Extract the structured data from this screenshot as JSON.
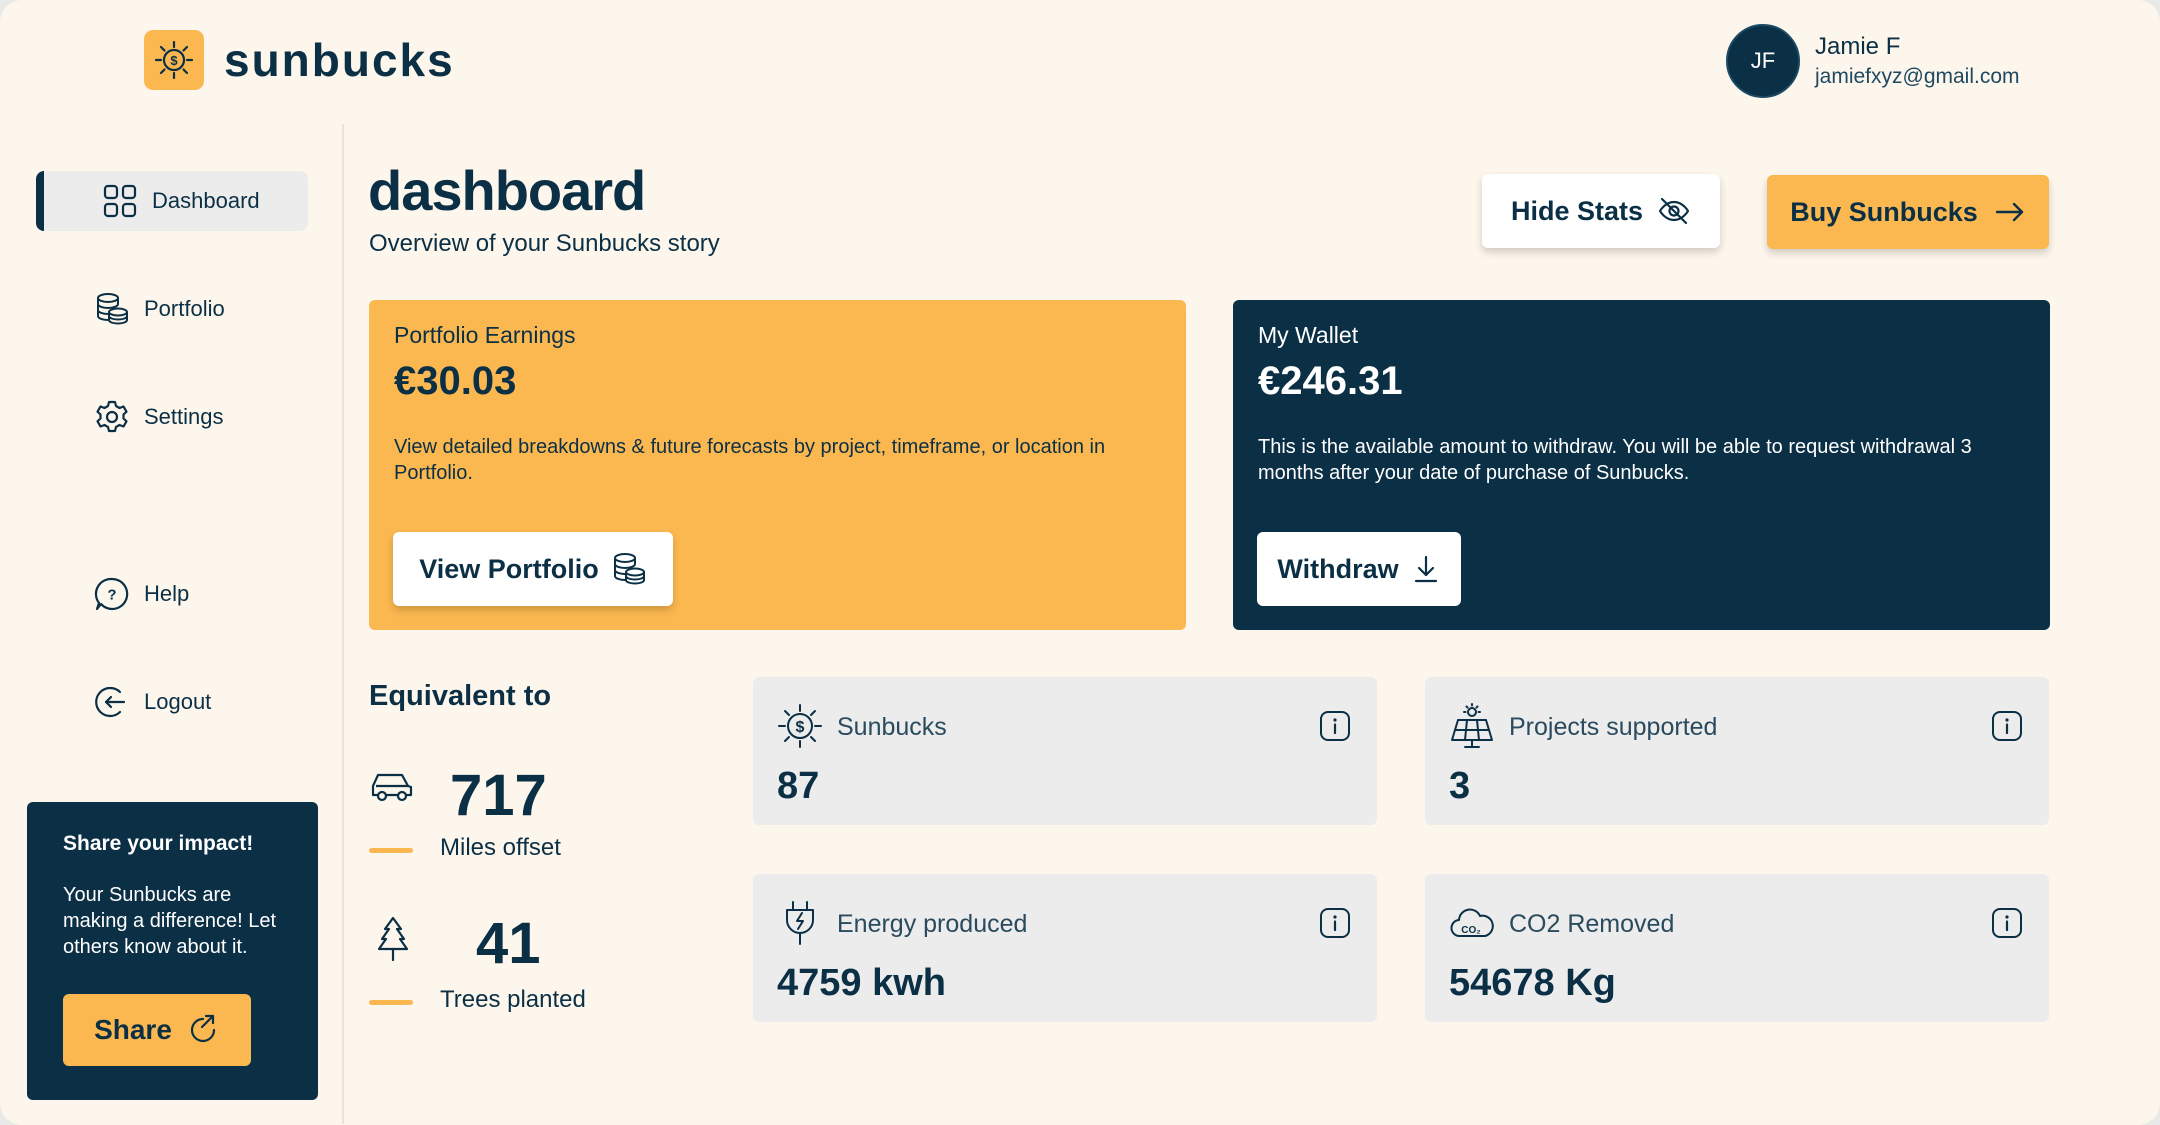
{
  "brand": {
    "name": "sunbucks",
    "accent": "#fbb850",
    "navy": "#0b2f45"
  },
  "user": {
    "initials": "JF",
    "name": "Jamie F",
    "email": "jamiefxyz@gmail.com"
  },
  "sidebar": {
    "items": [
      {
        "label": "Dashboard",
        "icon": "grid-icon",
        "active": true
      },
      {
        "label": "Portfolio",
        "icon": "coins-icon"
      },
      {
        "label": "Settings",
        "icon": "gear-icon"
      },
      {
        "label": "Help",
        "icon": "help-icon"
      },
      {
        "label": "Logout",
        "icon": "logout-icon"
      }
    ],
    "share": {
      "title": "Share your impact!",
      "body": "Your Sunbucks are making a difference! Let others know about it.",
      "button": "Share"
    }
  },
  "header": {
    "title": "dashboard",
    "subtitle": "Overview of your Sunbucks story",
    "hide_stats": "Hide Stats",
    "buy": "Buy Sunbucks"
  },
  "earnings": {
    "label": "Portfolio Earnings",
    "amount": "€30.03",
    "description": "View detailed breakdowns & future forecasts by project, timeframe, or location in Portfolio.",
    "button": "View Portfolio"
  },
  "wallet": {
    "label": "My Wallet",
    "amount": "€246.31",
    "description": "This is the available amount to withdraw. You will be able to request withdrawal 3 months after your date of purchase of Sunbucks.",
    "button": "Withdraw"
  },
  "equivalent": {
    "title": "Equivalent to",
    "items": [
      {
        "value": "717",
        "label": "Miles offset",
        "icon": "car-icon"
      },
      {
        "value": "41",
        "label": "Trees planted",
        "icon": "tree-icon"
      }
    ]
  },
  "stats": [
    {
      "label": "Sunbucks",
      "value": "87",
      "icon": "sun-coin-icon"
    },
    {
      "label": "Projects supported",
      "value": "3",
      "icon": "solar-panel-icon"
    },
    {
      "label": "Energy produced",
      "value": "4759 kwh",
      "icon": "plug-icon"
    },
    {
      "label": "CO2 Removed",
      "value": "54678 Kg",
      "icon": "co2-cloud-icon"
    }
  ]
}
